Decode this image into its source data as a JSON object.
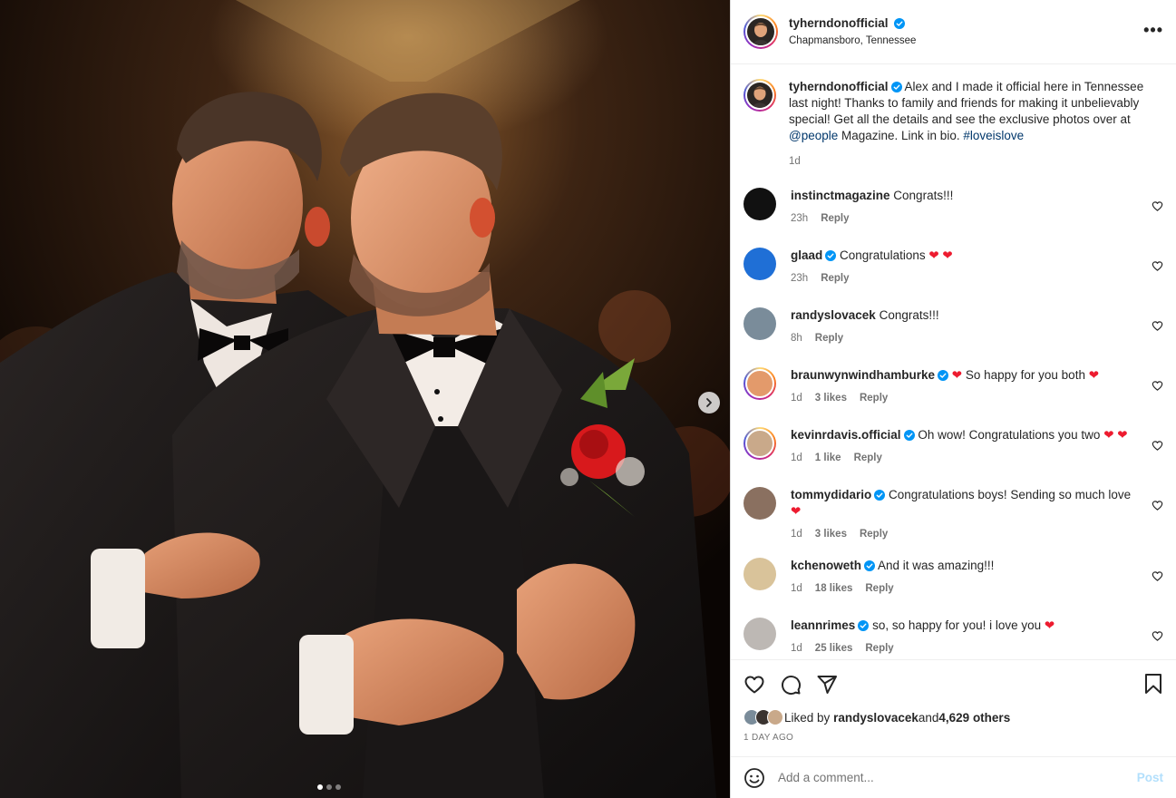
{
  "header": {
    "username": "tyherndonofficial",
    "location": "Chapmansboro, Tennessee",
    "more_icon": "more-horizontal-icon"
  },
  "caption": {
    "username": "tyherndonofficial",
    "text_before_mention": "Alex and I made it official here in Tennessee last night! Thanks to family and friends for making it unbelievably special! Get all the details and see the exclusive photos over at ",
    "mention": "@people",
    "text_after_mention": " Magazine. Link in bio. ",
    "hashtag": "#loveislove",
    "time": "1d"
  },
  "comments": [
    {
      "username": "instinctmagazine",
      "verified": false,
      "text": "Congrats!!!",
      "time": "23h",
      "likes": "",
      "reply": "Reply",
      "avatar_color": "#111111"
    },
    {
      "username": "glaad",
      "verified": true,
      "text": "Congratulations ❤️ ❤️",
      "time": "23h",
      "likes": "",
      "reply": "Reply",
      "avatar_color": "#1f6fd6"
    },
    {
      "username": "randyslovacek",
      "verified": false,
      "text": "Congrats!!!",
      "time": "8h",
      "likes": "",
      "reply": "Reply",
      "avatar_color": "#7a8c9a"
    },
    {
      "username": "braunwynwindhamburke",
      "verified": true,
      "text": "❤️ So happy for you both ❤️",
      "time": "1d",
      "likes": "3 likes",
      "reply": "Reply",
      "avatar_color": "#e39a6b"
    },
    {
      "username": "kevinrdavis.official",
      "verified": true,
      "text": "Oh wow! Congratulations you two ❤️ ❤️",
      "time": "1d",
      "likes": "1 like",
      "reply": "Reply",
      "avatar_color": "#c9a98a"
    },
    {
      "username": "tommydidario",
      "verified": true,
      "text": "Congratulations boys! Sending so much love ❤️",
      "time": "1d",
      "likes": "3 likes",
      "reply": "Reply",
      "avatar_color": "#8a7060"
    },
    {
      "username": "kchenoweth",
      "verified": true,
      "text": "And it was amazing!!!",
      "time": "1d",
      "likes": "18 likes",
      "reply": "Reply",
      "avatar_color": "#d9c39a"
    },
    {
      "username": "leannrimes",
      "verified": true,
      "text": "so, so happy for you! i love you ❤️",
      "time": "1d",
      "likes": "25 likes",
      "reply": "Reply",
      "avatar_color": "#bdb8b4"
    }
  ],
  "actions": {
    "like_icon": "heart-outline-icon",
    "comment_icon": "comment-bubble-icon",
    "share_icon": "paper-plane-icon",
    "save_icon": "bookmark-icon",
    "liked_by_prefix": "Liked by ",
    "liked_by_user": "randyslovacek",
    "liked_by_and": " and ",
    "liked_by_others": "4,629 others",
    "date": "1 DAY AGO"
  },
  "add_comment": {
    "emoji_icon": "smiley-icon",
    "placeholder": "Add a comment...",
    "post_label": "Post"
  },
  "carousel": {
    "total": 3,
    "active_index": 0,
    "next_icon": "chevron-right-icon"
  },
  "colors": {
    "verified_blue": "#0095f6",
    "link_blue": "#00376b",
    "heart_red": "#ed1b2f",
    "post_disabled": "#b2dffc",
    "muted_text": "#737373"
  }
}
